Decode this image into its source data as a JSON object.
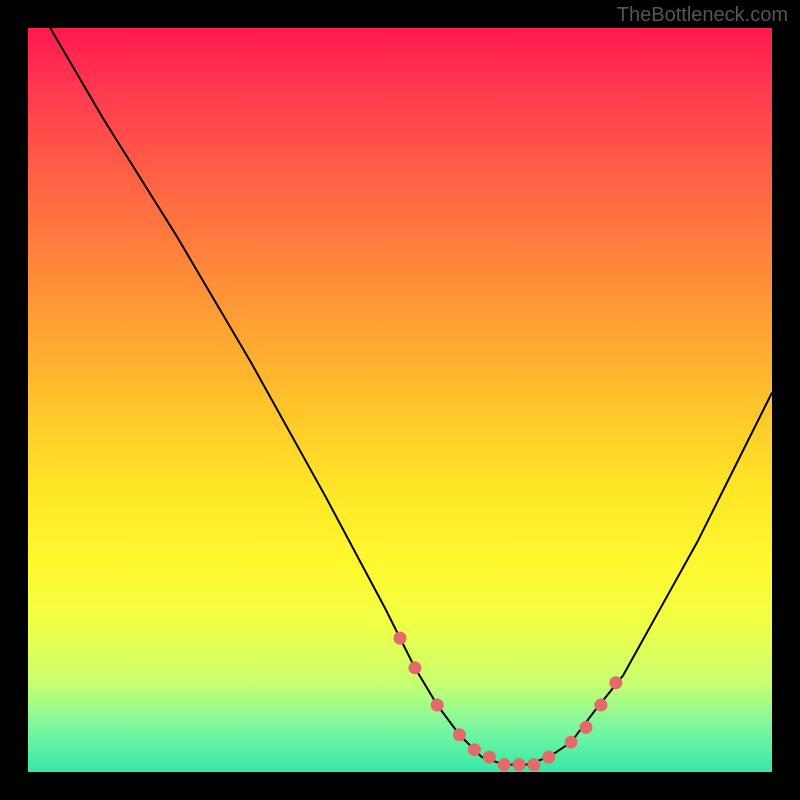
{
  "watermark": "TheBottleneck.com",
  "chart_data": {
    "type": "line",
    "title": "",
    "xlabel": "",
    "ylabel": "",
    "xlim": [
      0,
      100
    ],
    "ylim": [
      0,
      100
    ],
    "series": [
      {
        "name": "curve",
        "x": [
          3,
          10,
          20,
          30,
          40,
          48,
          52,
          55,
          58,
          61,
          64,
          67,
          70,
          73,
          76,
          80,
          85,
          90,
          95,
          100
        ],
        "y": [
          100,
          88,
          72,
          55,
          37,
          22,
          14,
          9,
          5,
          2,
          1,
          1,
          2,
          4,
          8,
          13,
          22,
          31,
          41,
          51
        ]
      }
    ],
    "highlight_points": {
      "x": [
        50,
        52,
        55,
        58,
        60,
        62,
        64,
        66,
        68,
        70,
        73,
        75,
        77,
        79
      ],
      "y": [
        18,
        14,
        9,
        5,
        3,
        2,
        1,
        1,
        1,
        2,
        4,
        6,
        9,
        12
      ]
    },
    "colors": {
      "curve": "#000000",
      "dots": "#e46a6a",
      "gradient_top": "#ff1a4d",
      "gradient_bottom": "#35e8a8"
    }
  }
}
